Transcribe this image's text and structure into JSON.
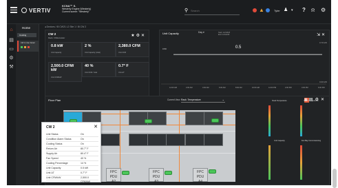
{
  "app": {
    "brand": "VERTIV",
    "site_line1": "KCNA™ S.",
    "site_line2": "Westerly Engine (Westerly)",
    "site_line3": "Current scene: \"Westerly\""
  },
  "search": {
    "placeholder": "Search"
  },
  "user": {
    "name": "Tyler"
  },
  "nav": {
    "title": "Home",
    "item": "Cooling",
    "thumb_title": "CW 2 | Fan Detail"
  },
  "breadcrumb": "◂ Devices / ⊞ CW21 L2 Site 1 / ⊞ CW 2",
  "device": {
    "title": "CW 2",
    "subtitle": "Rack, Chilled-water",
    "metrics": [
      {
        "value": "0.8 kW",
        "label": "Unit Capacity"
      },
      {
        "value": "2 %",
        "label": "Unit Capacity (total)"
      },
      {
        "value": "2,380.0 CFM",
        "label": "Unit CFM"
      },
      {
        "value": "2,500.0 CFM/ kW",
        "label": "Unit CFM/kW"
      },
      {
        "value": "40 %",
        "label": "Unit CFM / total"
      },
      {
        "value": "0.7° F",
        "label": "Unit ΔT"
      }
    ]
  },
  "chart": {
    "title": "Unit Capacity",
    "select": "Day",
    "meta1": "Start: 12/13/18",
    "meta2": "End: 12/14/18",
    "value_label": "0.5",
    "y_top": "0.70 kW",
    "y_mid": "0.50",
    "y_bot": "0.00 kW"
  },
  "chart_data": {
    "type": "line",
    "title": "Unit Capacity",
    "x": [
      "12:00 AM",
      "2:00 AM",
      "4:00 AM",
      "6:00 AM",
      "8:00 AM",
      "10:00 AM",
      "12:00 PM",
      "2:00 PM",
      "4:00 PM",
      "6:00 PM"
    ],
    "series": [
      {
        "values": [
          0.5,
          0.5,
          0.5,
          0.5,
          0.5,
          0.5,
          0.5,
          0.5,
          0.5,
          0.5
        ]
      }
    ],
    "ylim": [
      0,
      0.7
    ]
  },
  "floor": {
    "title": "Floor Plan",
    "view_label": "Current View",
    "view_value": "Rack: Temperature",
    "pdu_labels": [
      "FPC PDU",
      "FPC PDU",
      "FPC PDU"
    ],
    "pdu_ids": [
      "A2",
      "A3",
      "A4"
    ],
    "legend_left_title": "Rack Temperature",
    "legend_right_title": "Rack Temperature",
    "legend_left_sub": "Unit Capacity",
    "legend_right_sub": "Fan Bay Commissioning"
  },
  "tooltip": {
    "title": "CW 2",
    "rows": [
      {
        "k": "Unit Status",
        "v": "On"
      },
      {
        "k": "Condition Alarm Status",
        "v": "On"
      },
      {
        "k": "Cooling Status",
        "v": "On"
      },
      {
        "k": "Return Air",
        "v": "80.7° F"
      },
      {
        "k": "Supply Air",
        "v": "80.4° F"
      },
      {
        "k": "Fan Speed",
        "v": "40 %"
      },
      {
        "k": "Cooling Percentage",
        "v": "14 %"
      },
      {
        "k": "Unit Capacity",
        "v": "0.5 kW"
      },
      {
        "k": "Unit ΔT",
        "v": "0.7° F"
      },
      {
        "k": "Unit CFM/kW",
        "v": "2,500.0 CFM/kW"
      }
    ]
  },
  "colors": {
    "accent": "#e15a3a",
    "ok": "#4cc65a",
    "cold": "#29a9d8"
  }
}
